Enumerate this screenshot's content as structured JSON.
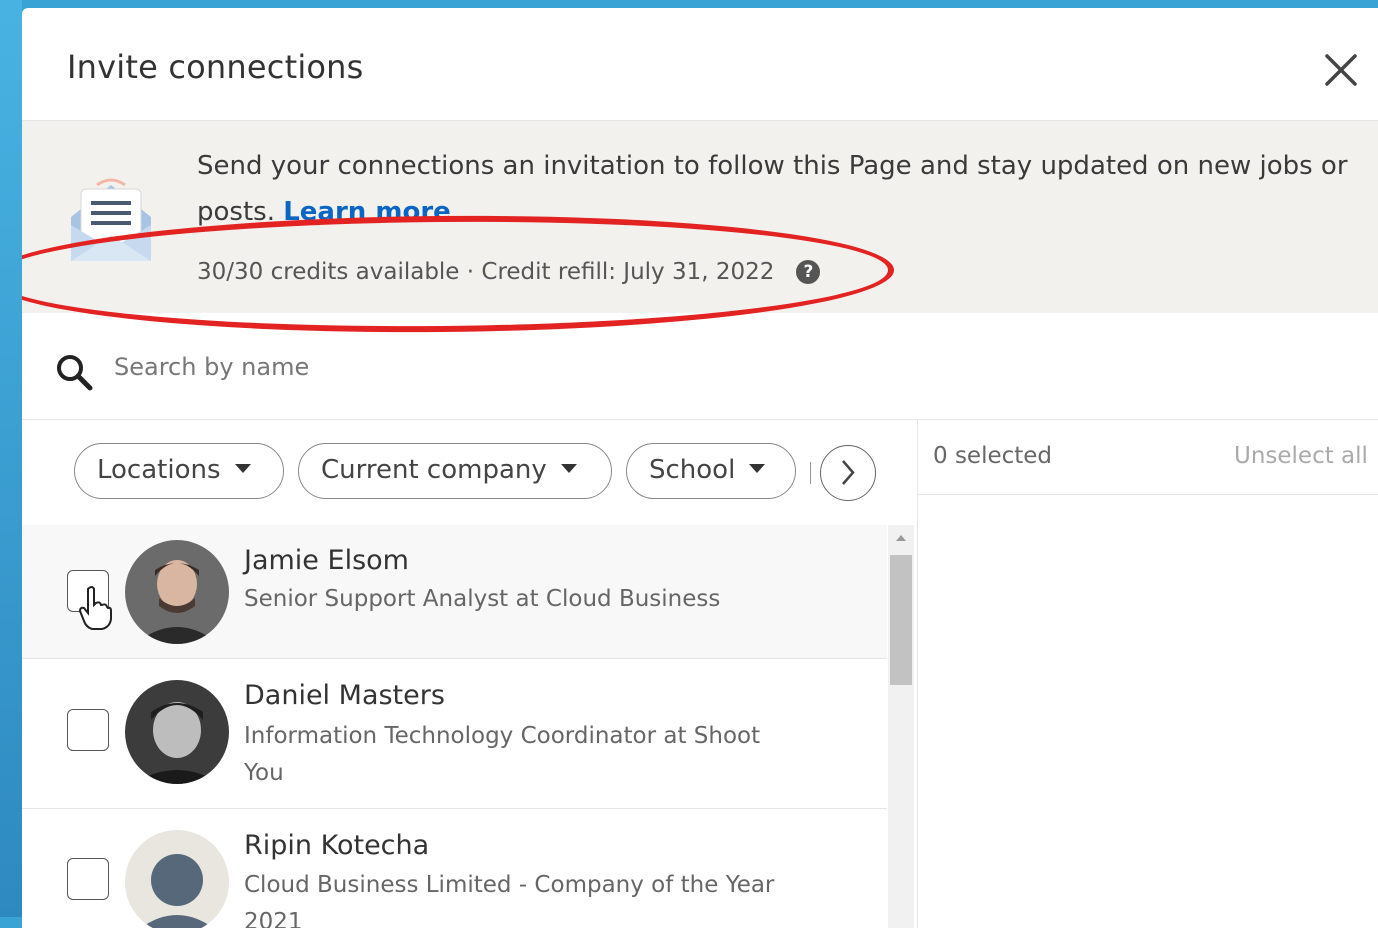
{
  "dialog": {
    "title": "Invite connections"
  },
  "banner": {
    "message": "Send your connections an invitation to follow this Page and stay updated on new jobs or posts.",
    "learn_more": "Learn more",
    "credits": "30/30 credits available · Credit refill: July 31, 2022",
    "help_glyph": "?"
  },
  "search": {
    "placeholder": "Search by name",
    "value": ""
  },
  "filters": [
    {
      "label": "Locations"
    },
    {
      "label": "Current company"
    },
    {
      "label": "School"
    }
  ],
  "selection": {
    "count_label": "0 selected",
    "unselect_all": "Unselect all"
  },
  "connections": [
    {
      "name": "Jamie Elsom",
      "headline": "Senior Support Analyst at Cloud Business",
      "checked": false
    },
    {
      "name": "Daniel Masters",
      "headline": "Information Technology Coordinator at Shoot You",
      "checked": false
    },
    {
      "name": "Ripin Kotecha",
      "headline": "Cloud Business Limited - Company of the Year 2021",
      "checked": false
    }
  ],
  "colors": {
    "accent": "#0a66c2",
    "annotation": "#e32222",
    "banner_bg": "#f3f1ee"
  }
}
